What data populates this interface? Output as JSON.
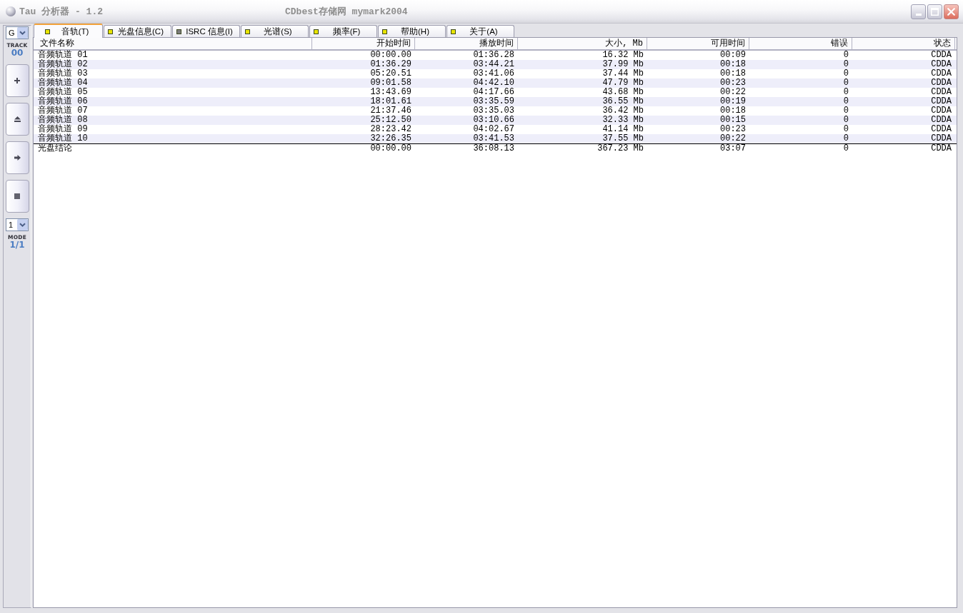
{
  "window": {
    "title": "Tau 分析器 - 1.2",
    "subtitle": "CDbest存储网 mymark2004"
  },
  "sidebar": {
    "drive_select": {
      "value": "G"
    },
    "track_label": "TRACK",
    "track_number": "00",
    "buttons": [
      {
        "kind": "add"
      },
      {
        "kind": "eject"
      },
      {
        "kind": "next"
      },
      {
        "kind": "stop"
      }
    ],
    "mode_select": {
      "value": "1"
    },
    "mode_label": "MODE",
    "mode_value": "1/1"
  },
  "tabs": [
    {
      "label": "音轨(T)",
      "selected": true,
      "color": "#e8e400"
    },
    {
      "label": "光盘信息(C)",
      "selected": false,
      "color": "#e8e400"
    },
    {
      "label": "ISRC 信息(I)",
      "selected": false,
      "color": "#7c7c7c"
    },
    {
      "label": "光谱(S)",
      "selected": false,
      "color": "#e8e400"
    },
    {
      "label": "频率(F)",
      "selected": false,
      "color": "#e8e400"
    },
    {
      "label": "帮助(H)",
      "selected": false,
      "color": "#e8e400"
    },
    {
      "label": "关于(A)",
      "selected": false,
      "color": "#e8e400"
    }
  ],
  "table": {
    "columns": [
      "文件名称",
      "开始时间",
      "播放时间",
      "大小, Mb",
      "可用时间",
      "错误",
      "状态"
    ],
    "rows": [
      {
        "cells": [
          "音频轨道 01",
          "00:00.00",
          "01:36.28",
          "16.32 Mb",
          "00:09",
          "0",
          "CDDA"
        ]
      },
      {
        "cells": [
          "音频轨道 02",
          "01:36.29",
          "03:44.21",
          "37.99 Mb",
          "00:18",
          "0",
          "CDDA"
        ]
      },
      {
        "cells": [
          "音频轨道 03",
          "05:20.51",
          "03:41.06",
          "37.44 Mb",
          "00:18",
          "0",
          "CDDA"
        ]
      },
      {
        "cells": [
          "音频轨道 04",
          "09:01.58",
          "04:42.10",
          "47.79 Mb",
          "00:23",
          "0",
          "CDDA"
        ]
      },
      {
        "cells": [
          "音频轨道 05",
          "13:43.69",
          "04:17.66",
          "43.68 Mb",
          "00:22",
          "0",
          "CDDA"
        ]
      },
      {
        "cells": [
          "音频轨道 06",
          "18:01.61",
          "03:35.59",
          "36.55 Mb",
          "00:19",
          "0",
          "CDDA"
        ]
      },
      {
        "cells": [
          "音频轨道 07",
          "21:37.46",
          "03:35.03",
          "36.42 Mb",
          "00:18",
          "0",
          "CDDA"
        ]
      },
      {
        "cells": [
          "音频轨道 08",
          "25:12.50",
          "03:10.66",
          "32.33 Mb",
          "00:15",
          "0",
          "CDDA"
        ]
      },
      {
        "cells": [
          "音频轨道 09",
          "28:23.42",
          "04:02.67",
          "41.14 Mb",
          "00:23",
          "0",
          "CDDA"
        ]
      },
      {
        "cells": [
          "音频轨道 10",
          "32:26.35",
          "03:41.53",
          "37.55 Mb",
          "00:22",
          "0",
          "CDDA"
        ]
      }
    ],
    "summary": {
      "cells": [
        "光盘结论",
        "00:00.00",
        "36:08.13",
        "367.23 Mb",
        "03:07",
        "0",
        "CDDA"
      ]
    }
  }
}
